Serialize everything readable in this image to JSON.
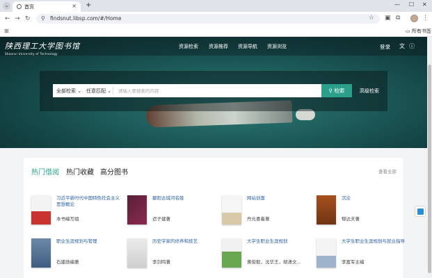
{
  "browser": {
    "tab_title": "首页",
    "url": "findsnut.libsp.com/#/Home",
    "bookmarks_folder": "所有书签"
  },
  "site": {
    "logo_cn": "陕西理工大学图书馆",
    "logo_en": "Shaanxi University of Technology",
    "nav": [
      "资源检索",
      "资源推荐",
      "资源导航",
      "资源浏览"
    ],
    "login": "登录"
  },
  "search": {
    "scope": "全部检索",
    "match": "任意匹配",
    "placeholder": "请输入要搜索的内容",
    "button": "检索",
    "advanced": "高级检索"
  },
  "section": {
    "tabs": [
      "热门借阅",
      "热门收藏",
      "高分图书"
    ],
    "view_all": "查看全部",
    "books": [
      {
        "title": "习近平新时代中国特色社会主义思想概论",
        "author": "本书编写组"
      },
      {
        "title": "鄱阳古城河名胜",
        "author": "迟子建著"
      },
      {
        "title": "网站创富",
        "author": "丹元喜着著"
      },
      {
        "title": "沉沦",
        "author": "郁达夫著"
      },
      {
        "title": "职业生涯规划与管理",
        "author": "石建勋编著"
      },
      {
        "title": "历史学家的修养和技艺",
        "author": "李剑鸣著"
      },
      {
        "title": "大学生职业生涯规划",
        "author": "黄俊毅，沈华王，胡潇文..."
      },
      {
        "title": "大学生职业生涯规划与就业指导",
        "author": "李富军主编"
      }
    ]
  },
  "colors": {
    "accent": "#2aa08a",
    "link": "#2a5fa8",
    "hero": "#1d5b5a"
  }
}
